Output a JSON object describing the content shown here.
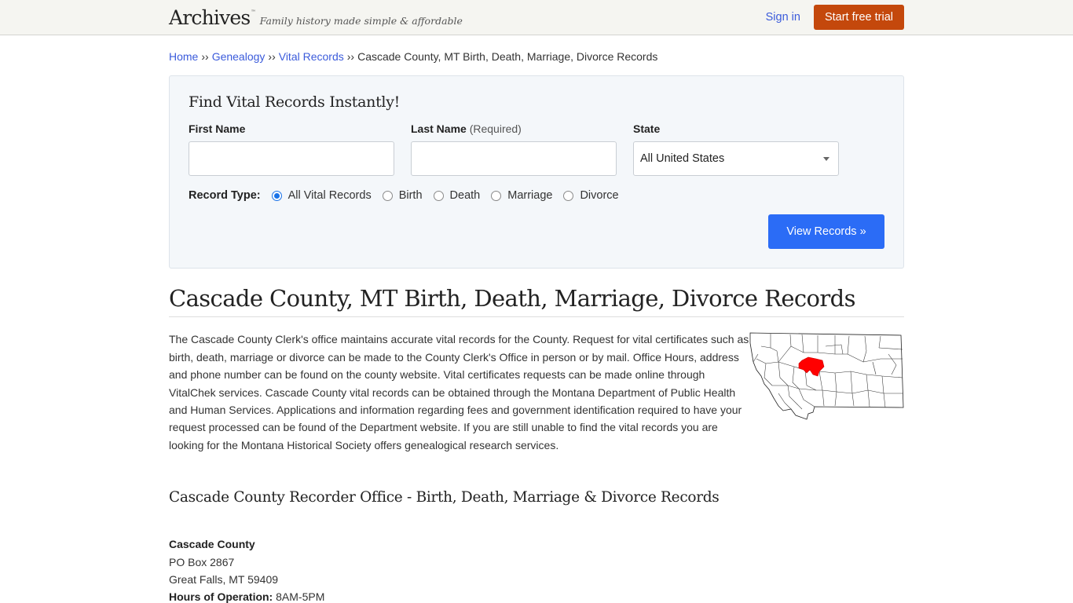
{
  "header": {
    "logo": "Archives",
    "logo_tm": "™",
    "tagline": "Family history made simple & affordable",
    "signin_label": "Sign in",
    "trial_label": "Start free trial",
    "trial_color": "#c4480c"
  },
  "breadcrumb": {
    "items": [
      {
        "label": "Home"
      },
      {
        "label": "Genealogy"
      },
      {
        "label": "Vital Records"
      }
    ],
    "separator": "››",
    "current": "Cascade County, MT Birth, Death, Marriage, Divorce Records"
  },
  "search": {
    "title": "Find Vital Records Instantly!",
    "first_name_label": "First Name",
    "first_name_value": "",
    "last_name_label": "Last Name",
    "last_name_required": "(Required)",
    "last_name_value": "",
    "state_label": "State",
    "state_selected": "All United States",
    "record_type_label": "Record Type:",
    "record_types": [
      {
        "label": "All Vital Records",
        "checked": true
      },
      {
        "label": "Birth",
        "checked": false
      },
      {
        "label": "Death",
        "checked": false
      },
      {
        "label": "Marriage",
        "checked": false
      },
      {
        "label": "Divorce",
        "checked": false
      }
    ],
    "submit_label": "View Records »",
    "submit_color": "#2b6cf6"
  },
  "main": {
    "title": "Cascade County, MT Birth, Death, Marriage, Divorce Records",
    "intro": "The Cascade County Clerk's office maintains accurate vital records for the County. Request for vital certificates such as birth, death, marriage or divorce can be made to the County Clerk's Office in person or by mail. Office Hours, address and phone number can be found on the county website. Vital certificates requests can be made online through VitalChek services. Cascade County vital records can be obtained through the Montana Department of Public Health and Human Services. Applications and information regarding fees and government identification required to have your request processed can be found of the Department website. If you are still unable to find the vital records you are looking for the Montana Historical Society offers genealogical research services.",
    "map_alt": "Montana county map with Cascade County highlighted",
    "map_highlight_color": "#ff0000",
    "section_title": "Cascade County Recorder Office - Birth, Death, Marriage & Divorce Records",
    "office": {
      "name": "Cascade County",
      "address1": "PO Box 2867",
      "address2": "Great Falls, MT 59409",
      "hours_label": "Hours of Operation:",
      "hours": "8AM-5PM"
    }
  }
}
